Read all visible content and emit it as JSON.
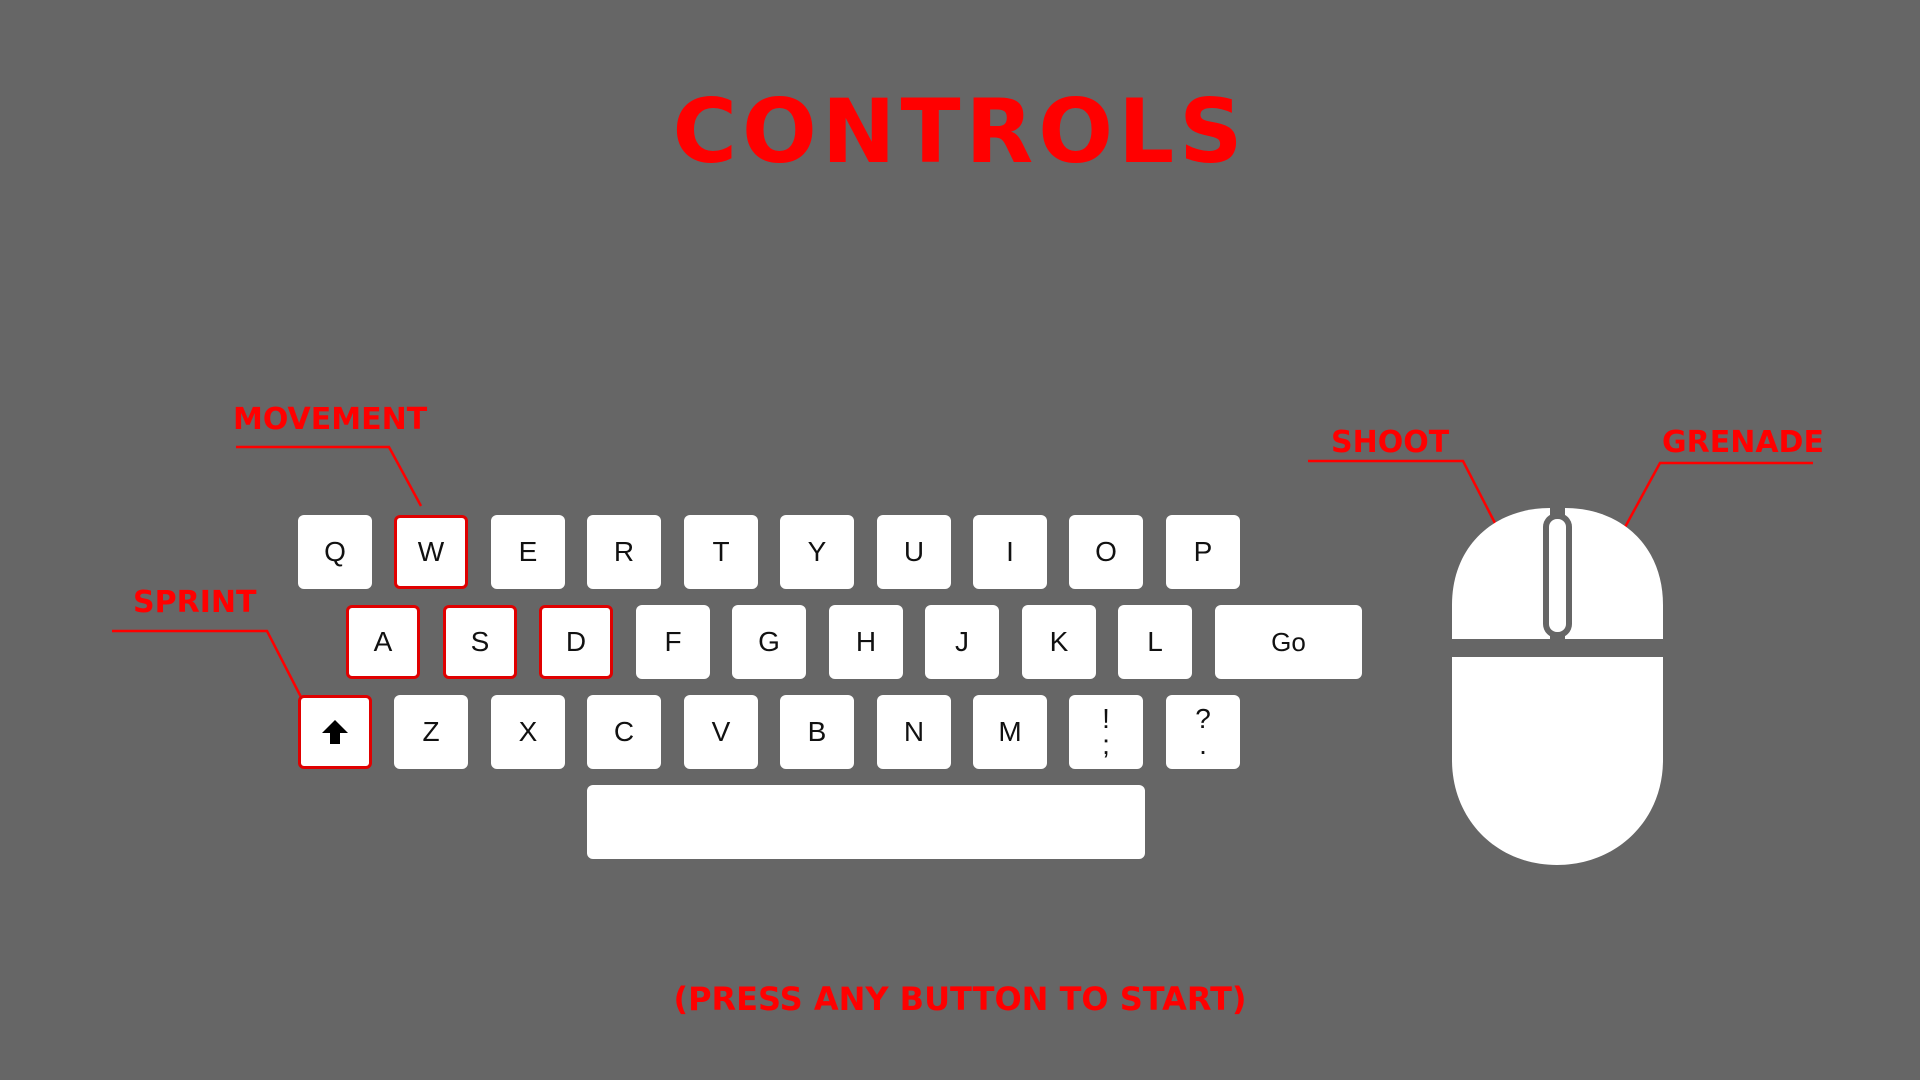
{
  "title": "CONTROLS",
  "labels": {
    "movement": "MOVEMENT",
    "sprint": "SPRINT",
    "shoot": "SHOOT",
    "grenade": "GRENADE"
  },
  "keyboard": {
    "row1": [
      "Q",
      "W",
      "E",
      "R",
      "T",
      "Y",
      "U",
      "I",
      "O",
      "P"
    ],
    "row2": [
      "A",
      "S",
      "D",
      "F",
      "G",
      "H",
      "J",
      "K",
      "L"
    ],
    "go": "Go",
    "row3": [
      "Z",
      "X",
      "C",
      "V",
      "B",
      "N",
      "M"
    ],
    "punct1": {
      "top": "!",
      "bottom": ";"
    },
    "punct2": {
      "top": "?",
      "bottom": "."
    }
  },
  "prompt": "(PRESS ANY BUTTON TO START)",
  "colors": {
    "background": "#666666",
    "accent": "#ff0000",
    "key": "#ffffff"
  },
  "icons": [
    "shift-arrow-icon",
    "mouse-icon"
  ]
}
